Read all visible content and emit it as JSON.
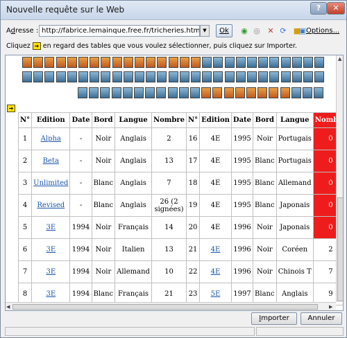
{
  "window": {
    "title": "Nouvelle requête sur le Web"
  },
  "address": {
    "label_prefix": "A",
    "label_underline": "d",
    "label_rest": "resse :",
    "value": "http://fabrice.lemainque.free.fr/tricheries.html",
    "ok_label": "Ok",
    "options_label": "Options..."
  },
  "instruction": {
    "before": "Cliquez",
    "after": "en regard des tables que vous voulez sélectionner, puis cliquez sur Importer."
  },
  "table": {
    "headers": [
      "N°",
      "Edition",
      "Date",
      "Bord",
      "Langue",
      "Nombre",
      "N°",
      "Edition",
      "Date",
      "Bord",
      "Langue",
      "Nombre"
    ],
    "rows": [
      [
        "1",
        "Alpha",
        "-",
        "Noir",
        "Anglais",
        "2",
        "16",
        "4E",
        "1995",
        "Noir",
        "Portugais",
        "0"
      ],
      [
        "2",
        "Beta",
        "-",
        "Noir",
        "Anglais",
        "13",
        "17",
        "4E",
        "1995",
        "Blanc",
        "Portugais",
        "0"
      ],
      [
        "3",
        "Unlimited",
        "-",
        "Blanc",
        "Anglais",
        "7",
        "18",
        "4E",
        "1995",
        "Blanc",
        "Allemand",
        "0"
      ],
      [
        "4",
        "Revised",
        "-",
        "Blanc",
        "Anglais",
        "26 (2 signées)",
        "19",
        "4E",
        "1995",
        "Blanc",
        "Japonais",
        "0"
      ],
      [
        "5",
        "3E",
        "1994",
        "Noir",
        "Français",
        "14",
        "20",
        "4E",
        "1996",
        "Noir",
        "Japonais",
        "0"
      ],
      [
        "6",
        "3E",
        "1994",
        "Noir",
        "Italien",
        "13",
        "21",
        "4E",
        "1996",
        "Noir",
        "Coréen",
        "2"
      ],
      [
        "7",
        "3E",
        "1994",
        "Noir",
        "Allemand",
        "10",
        "22",
        "4E",
        "1996",
        "Noir",
        "Chinois T",
        "7"
      ],
      [
        "8",
        "3E",
        "1994",
        "Blanc",
        "Français",
        "21",
        "23",
        "5E",
        "1997",
        "Blanc",
        "Anglais",
        "9"
      ]
    ],
    "linked_left": [
      true,
      true,
      true,
      true,
      true,
      true,
      true,
      true
    ],
    "linked_right": [
      false,
      false,
      false,
      false,
      false,
      true,
      true,
      true
    ],
    "red_right": [
      true,
      true,
      true,
      true,
      true,
      false,
      false,
      false
    ]
  },
  "buttons": {
    "import_prefix": "I",
    "import_rest": "mporter",
    "cancel": "Annuler"
  },
  "colors": {
    "highlight_red": "#ee1c1c",
    "link_blue": "#1a55a8",
    "arrow_yellow": "#ffe100"
  }
}
